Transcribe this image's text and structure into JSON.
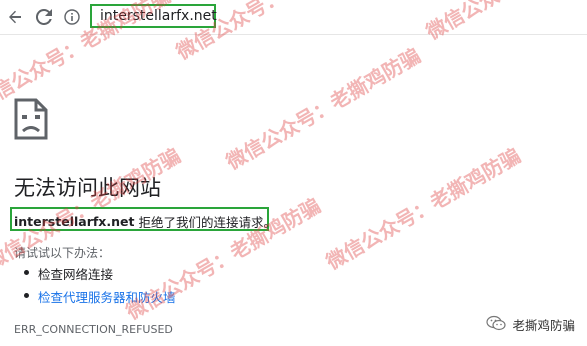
{
  "browser": {
    "url": "interstellarfx.net",
    "icons": {
      "back": "back-arrow-icon",
      "reload": "reload-icon",
      "info": "info-icon"
    }
  },
  "error": {
    "icon": "sad-page-icon",
    "title": "无法访问此网站",
    "host": "interstellarfx.net",
    "message": "拒绝了我们的连接请求。",
    "try_label": "请试试以下办法：",
    "suggestions": [
      "检查网络连接",
      "检查代理服务器和防火墙"
    ],
    "code": "ERR_CONNECTION_REFUSED"
  },
  "watermark": {
    "text": "微信公众号：老撕鸡防骗",
    "color": "#dc3c3c"
  },
  "source_badge": {
    "icon": "wechat-icon",
    "label": "老撕鸡防骗"
  },
  "colors": {
    "highlight": "#2aa53a",
    "link": "#1a73e8"
  }
}
